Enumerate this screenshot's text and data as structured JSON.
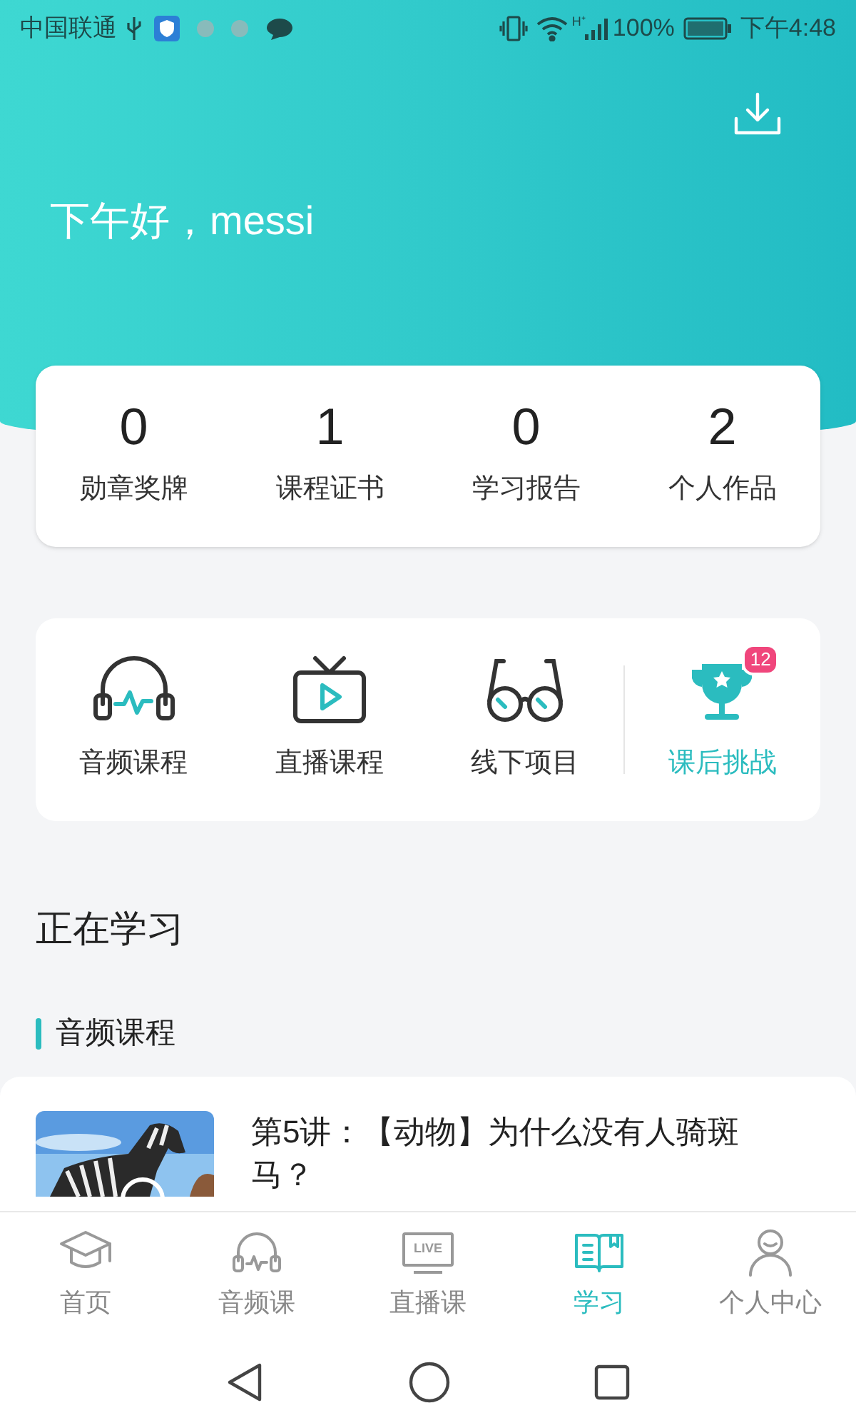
{
  "status_bar": {
    "carrier": "中国联通",
    "network_type": "H⁺",
    "battery": "100%",
    "time": "下午4:48"
  },
  "greeting": "下午好，messi",
  "stats": [
    {
      "value": "0",
      "label": "勋章奖牌"
    },
    {
      "value": "1",
      "label": "课程证书"
    },
    {
      "value": "0",
      "label": "学习报告"
    },
    {
      "value": "2",
      "label": "个人作品"
    }
  ],
  "features": [
    {
      "kind": "audio",
      "label": "音频课程",
      "selected": false
    },
    {
      "kind": "live",
      "label": "直播课程",
      "selected": false
    },
    {
      "kind": "offline",
      "label": "线下项目",
      "selected": false
    },
    {
      "kind": "challenge",
      "label": "课后挑战",
      "selected": true,
      "badge": "12"
    }
  ],
  "learning": {
    "title": "正在学习",
    "section": "音频课程",
    "course": {
      "title": "第5讲：【动物】为什么没有人骑斑马？"
    }
  },
  "tabs": [
    {
      "kind": "home",
      "label": "首页",
      "selected": false
    },
    {
      "kind": "audio",
      "label": "音频课",
      "selected": false
    },
    {
      "kind": "live",
      "label": "直播课",
      "selected": false,
      "icon_text": "LIVE"
    },
    {
      "kind": "study",
      "label": "学习",
      "selected": true
    },
    {
      "kind": "profile",
      "label": "个人中心",
      "selected": false
    }
  ]
}
